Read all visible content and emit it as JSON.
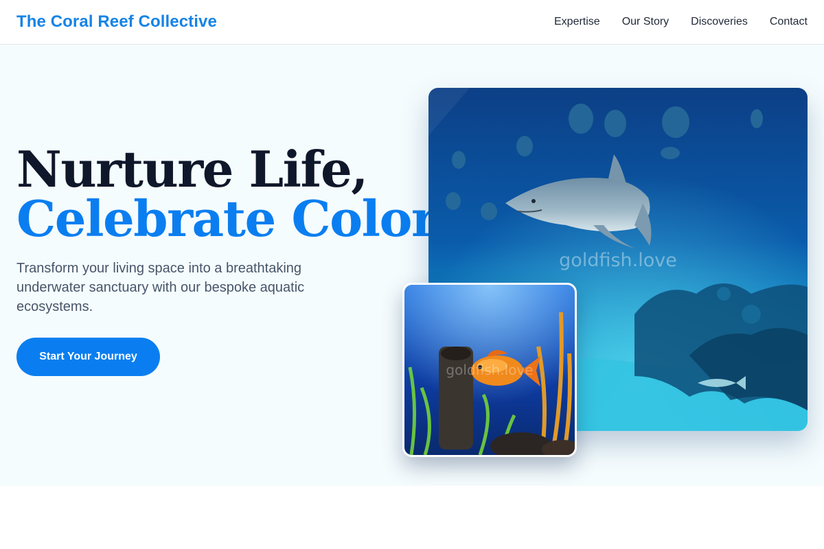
{
  "header": {
    "brand": "The Coral Reef Collective",
    "nav": [
      {
        "label": "Expertise"
      },
      {
        "label": "Our Story"
      },
      {
        "label": "Discoveries"
      },
      {
        "label": "Contact"
      }
    ]
  },
  "hero": {
    "headline_line1": "Nurture Life,",
    "headline_line2": "Celebrate Color.",
    "subtitle": "Transform your living space into a breathtaking underwater sanctuary with our bespoke aquatic ecosystems.",
    "cta_label": "Start Your Journey",
    "main_image": {
      "subject": "shark in large aquarium",
      "watermark": "goldfish.love"
    },
    "small_image": {
      "subject": "orange fish in planted aquarium",
      "watermark": "goldfish.love"
    }
  },
  "colors": {
    "brand": "#1683e6",
    "accent": "#0a7ef0",
    "hero_background": "#f5fcfe",
    "headline": "#0f172a"
  }
}
